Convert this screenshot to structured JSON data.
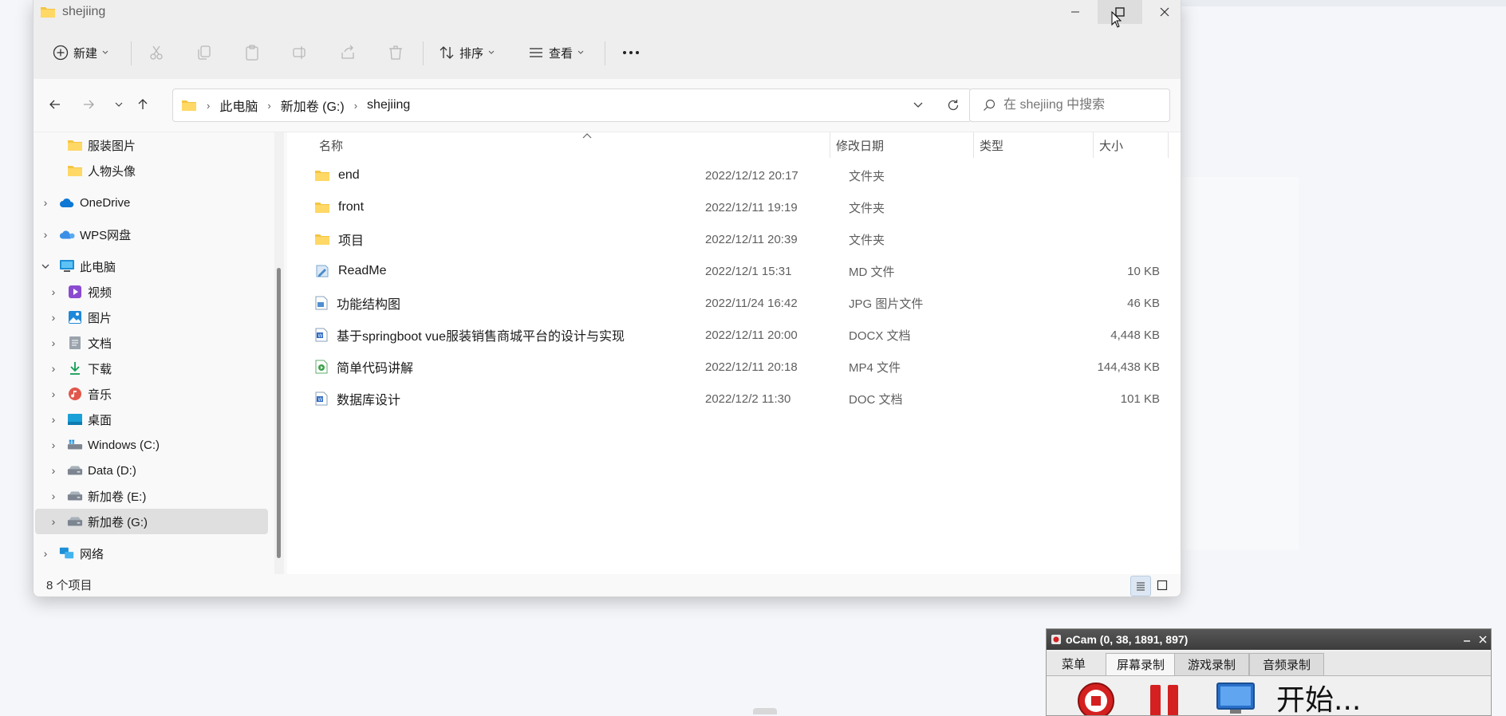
{
  "window": {
    "title": "shejiing"
  },
  "toolbar": {
    "new_label": "新建",
    "sort_label": "排序",
    "view_label": "查看"
  },
  "address": {
    "crumbs": [
      "此电脑",
      "新加卷 (G:)",
      "shejiing"
    ],
    "search_placeholder": "在 shejiing 中搜索"
  },
  "sidebar": {
    "items": [
      {
        "label": "服装图片"
      },
      {
        "label": "人物头像"
      },
      {
        "label": "OneDrive"
      },
      {
        "label": "WPS网盘"
      },
      {
        "label": "此电脑"
      },
      {
        "label": "视频"
      },
      {
        "label": "图片"
      },
      {
        "label": "文档"
      },
      {
        "label": "下载"
      },
      {
        "label": "音乐"
      },
      {
        "label": "桌面"
      },
      {
        "label": "Windows (C:)"
      },
      {
        "label": "Data (D:)"
      },
      {
        "label": "新加卷 (E:)"
      },
      {
        "label": "新加卷 (G:)"
      },
      {
        "label": "网络"
      }
    ]
  },
  "columns": {
    "name": "名称",
    "date": "修改日期",
    "type": "类型",
    "size": "大小"
  },
  "files": [
    {
      "name": "end",
      "date": "2022/12/12 20:17",
      "type": "文件夹",
      "size": ""
    },
    {
      "name": "front",
      "date": "2022/12/11 19:19",
      "type": "文件夹",
      "size": ""
    },
    {
      "name": "项目",
      "date": "2022/12/11 20:39",
      "type": "文件夹",
      "size": ""
    },
    {
      "name": "ReadMe",
      "date": "2022/12/1 15:31",
      "type": "MD 文件",
      "size": "10 KB"
    },
    {
      "name": "功能结构图",
      "date": "2022/11/24 16:42",
      "type": "JPG 图片文件",
      "size": "46 KB"
    },
    {
      "name": "基于springboot vue服装销售商城平台的设计与实现",
      "date": "2022/12/11 20:00",
      "type": "DOCX 文档",
      "size": "4,448 KB"
    },
    {
      "name": "简单代码讲解",
      "date": "2022/12/11 20:18",
      "type": "MP4 文件",
      "size": "144,438 KB"
    },
    {
      "name": "数据库设计",
      "date": "2022/12/2 11:30",
      "type": "DOC 文档",
      "size": "101 KB"
    }
  ],
  "status": {
    "count": "8 个项目"
  },
  "ocam": {
    "title": "oCam (0, 38, 1891, 897)",
    "tabs": [
      "菜单",
      "屏幕录制",
      "游戏录制",
      "音频录制"
    ],
    "start_label": "开始..."
  },
  "colors": {
    "folder": "#f4c542",
    "accent": "#0067c0",
    "record_red": "#d42020"
  }
}
